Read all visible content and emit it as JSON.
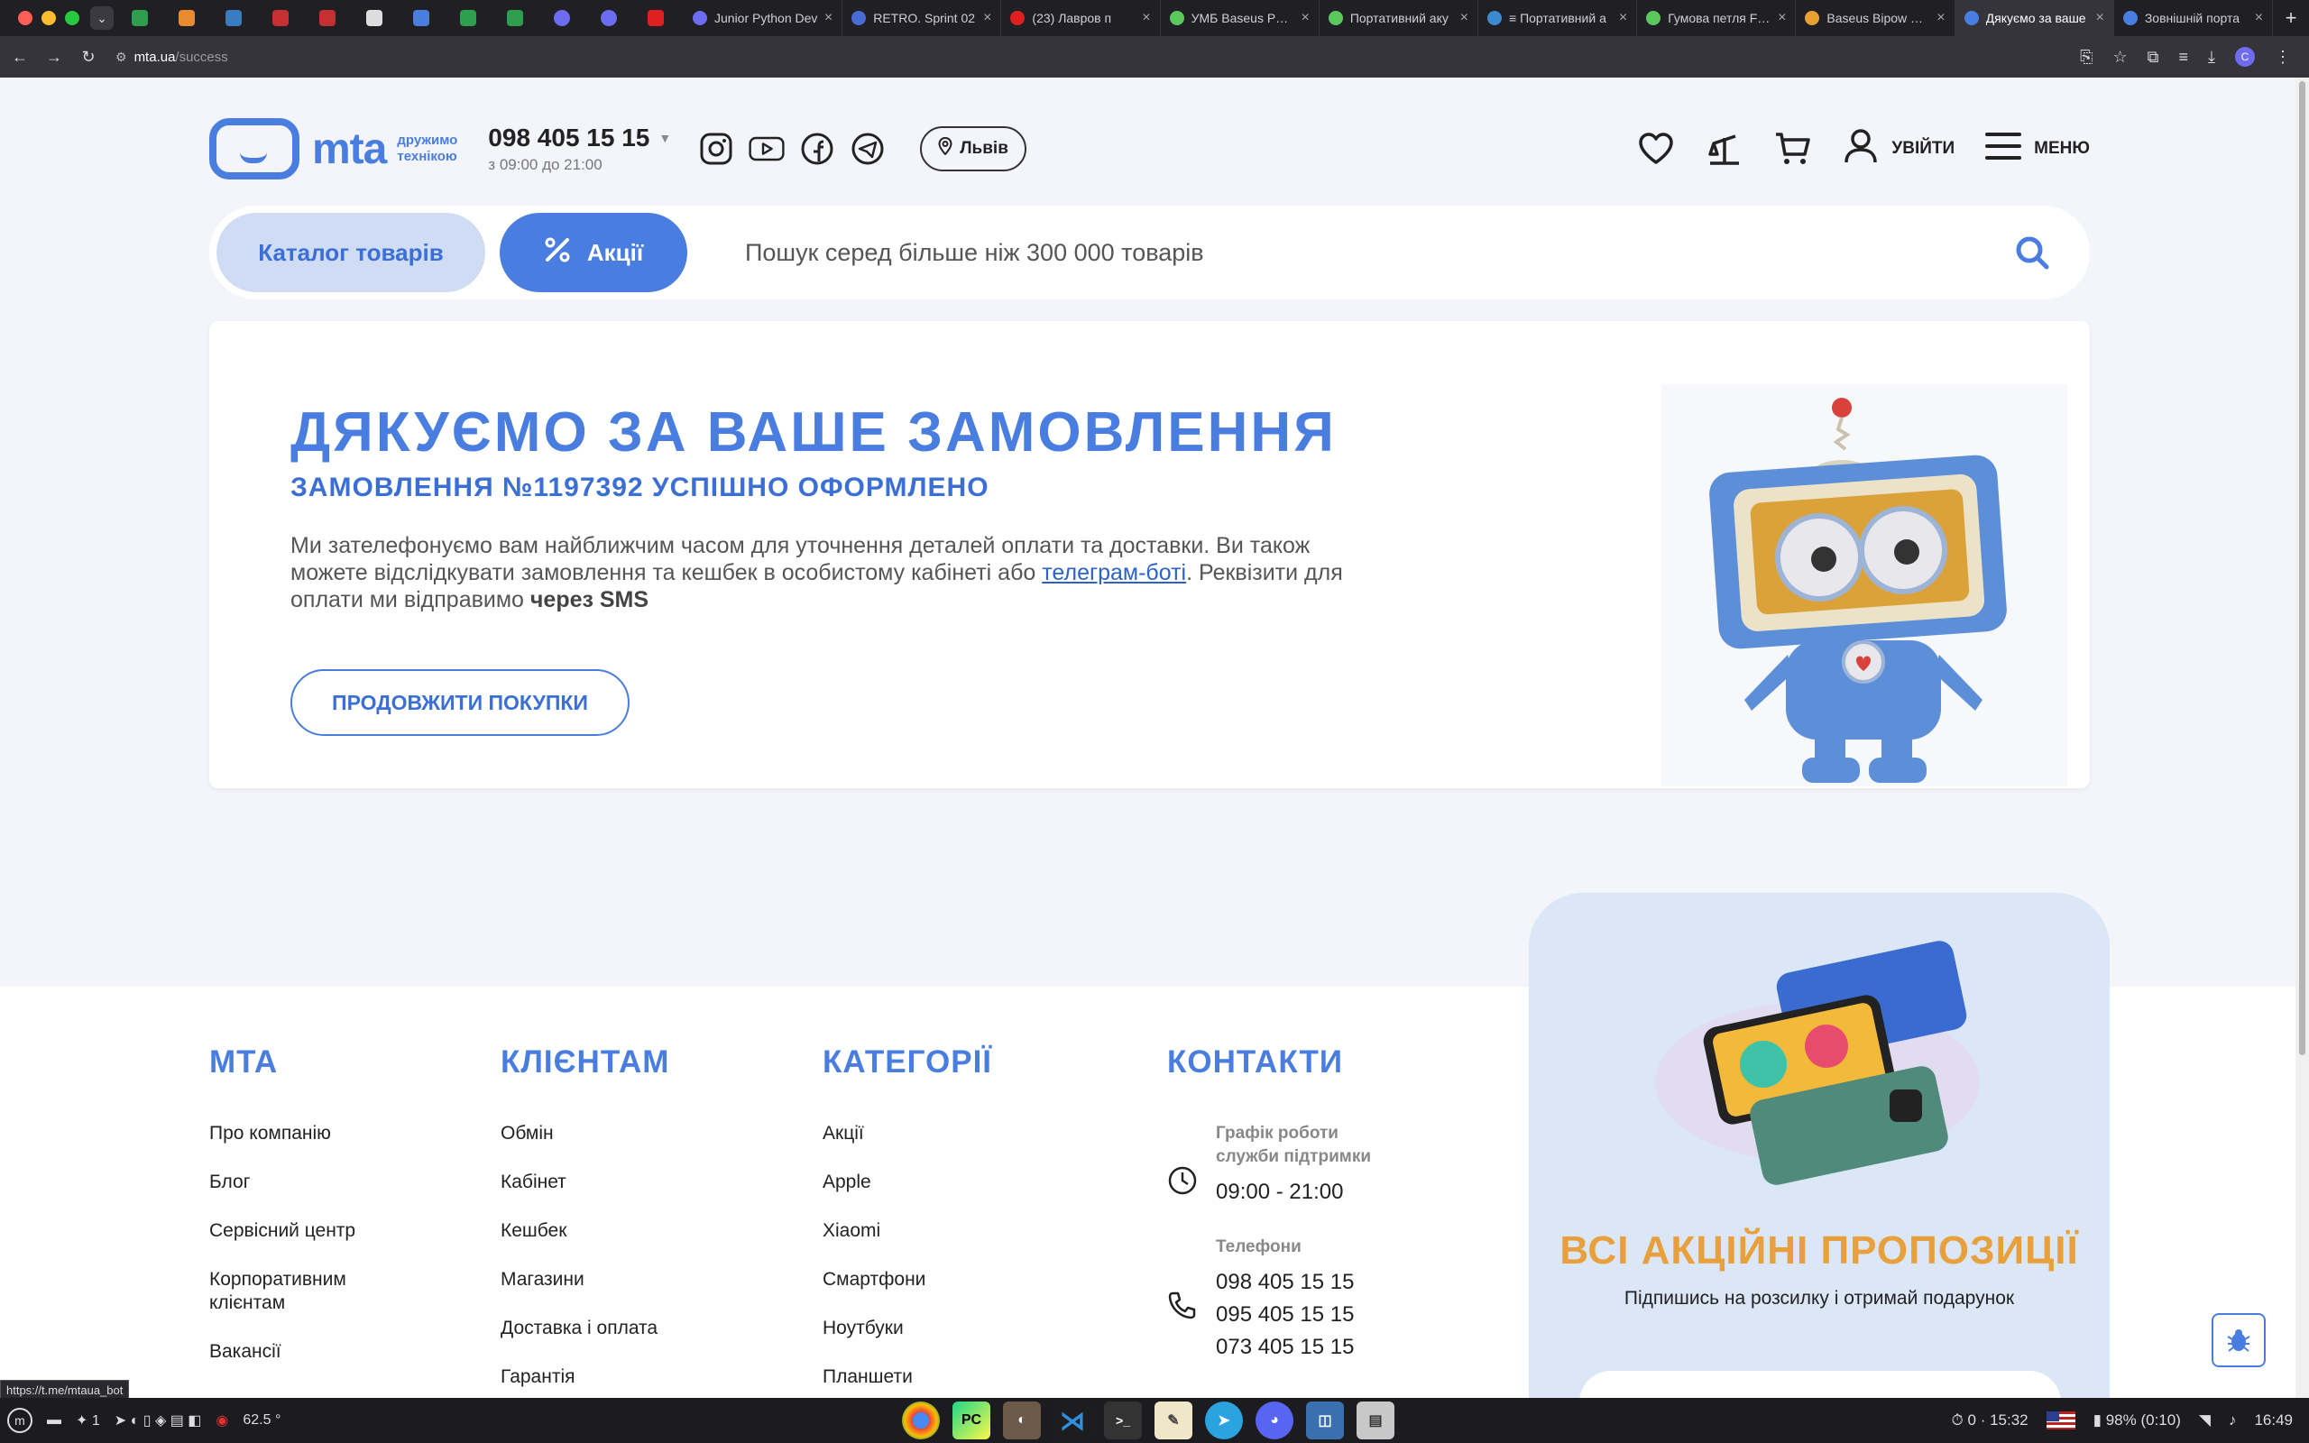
{
  "browser": {
    "tabs": [
      {
        "label": "Junior Python Dev",
        "color": "#6c6cf0"
      },
      {
        "label": "RETRO. Sprint 02",
        "color": "#4a6ad8"
      },
      {
        "label": "(23) Лавров п",
        "color": "#e02020"
      },
      {
        "label": "УМБ Baseus PPDM",
        "color": "#5ac85a"
      },
      {
        "label": "Портативний аку",
        "color": "#5ac85a"
      },
      {
        "label": "≡ Портативний а",
        "color": "#3a8ad0"
      },
      {
        "label": "Гумова петля FITN",
        "color": "#5ac85a"
      },
      {
        "label": "Baseus Bipow Digi",
        "color": "#e8a030"
      },
      {
        "label": "Дякуємо за ваше",
        "color": "#4a7de0",
        "active": true
      },
      {
        "label": "Зовнішній порта",
        "color": "#4a7de0"
      }
    ],
    "url_host": "mta.ua",
    "url_path": "/success",
    "avatar_letter": "C",
    "status_url": "https://t.me/mtaua_bot"
  },
  "header": {
    "logo_text": "mta",
    "logo_sub_1": "дружимо",
    "logo_sub_2": "технікою",
    "phone": "098 405 15 15",
    "hours": "з 09:00 до 21:00",
    "city": "Львів",
    "login": "УВІЙТИ",
    "menu": "МЕНЮ"
  },
  "search": {
    "catalog_label": "Каталог товарів",
    "promo_label": "Акції",
    "placeholder": "Пошук серед більше ніж 300 000 товарів"
  },
  "success": {
    "title": "ДЯКУЄМО ЗА ВАШЕ ЗАМОВЛЕННЯ",
    "subtitle": "ЗАМОВЛЕННЯ №1197392 УСПІШНО ОФОРМЛЕНО",
    "msg_part1": "Ми зателефонуємо вам найближчим часом для уточнення деталей оплати та доставки. Ви також можете відслідкувати замовлення та кешбек в особистому кабінеті або ",
    "msg_link": "телеграм-боті",
    "msg_part2": ". Реквізити для оплати ми відправимо ",
    "msg_bold": "через SMS",
    "continue_label": "ПРОДОВЖИТИ ПОКУПКИ"
  },
  "footer": {
    "col_mta": {
      "title": "MTA",
      "items": [
        "Про компанію",
        "Блог",
        "Сервісний центр",
        "Корпоративним клієнтам",
        "Вакансії"
      ]
    },
    "col_clients": {
      "title": "КЛІЄНТАМ",
      "items": [
        "Обмін",
        "Кабінет",
        "Кешбек",
        "Магазини",
        "Доставка і оплата",
        "Гарантія"
      ]
    },
    "col_categories": {
      "title": "КАТЕГОРІЇ",
      "items": [
        "Акції",
        "Apple",
        "Xiaomi",
        "Смартфони",
        "Ноутбуки",
        "Планшети"
      ]
    },
    "contacts": {
      "title": "КОНТАКТИ",
      "schedule_label": "Графік роботи служби підтримки",
      "schedule_value": "09:00 - 21:00",
      "phones_label": "Телефони",
      "phones": [
        "098 405 15 15",
        "095 405 15 15",
        "073 405 15 15"
      ]
    },
    "promo": {
      "title": "ВСІ АКЦІЙНІ ПРОПОЗИЦІЇ",
      "subtitle": "Підпишись на розсилку і отримай подарунок"
    }
  },
  "taskbar": {
    "workspace": "1",
    "temp": "62.5 °",
    "timer": "0 · 15:32",
    "battery": "98% (0:10)",
    "clock": "16:49"
  },
  "colors": {
    "brand_blue": "#4a7de0",
    "promo_orange": "#e8a03c"
  }
}
